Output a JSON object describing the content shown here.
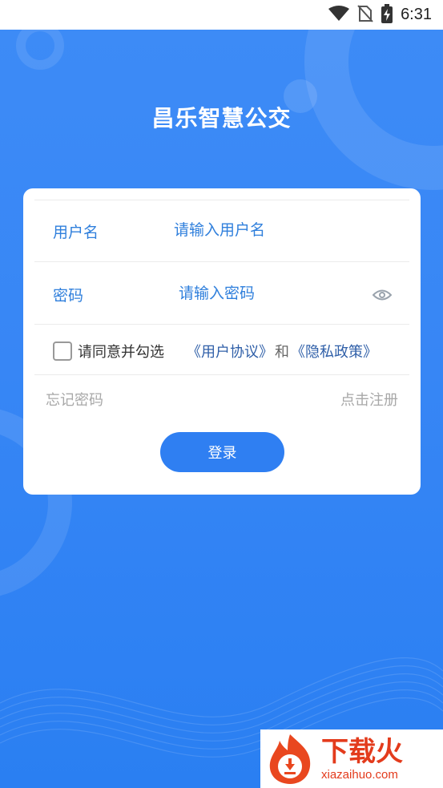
{
  "status_bar": {
    "time": "6:31",
    "icons": [
      "wifi-icon",
      "no-sim-icon",
      "battery-charging-icon"
    ]
  },
  "app": {
    "title": "昌乐智慧公交"
  },
  "login_form": {
    "username_label": "用户名",
    "username_placeholder": "请输入用户名",
    "password_label": "密码",
    "password_placeholder": "请输入密码",
    "password_toggle_icon": "eye-icon",
    "agreement_text": "请同意并勾选",
    "user_agreement_link": "《用户协议》",
    "and_text": "和",
    "privacy_policy_link": "《隐私政策》",
    "agreement_checked": false,
    "forgot_password": "忘记密码",
    "register": "点击注册",
    "login_button": "登录"
  },
  "watermark": {
    "brand_cn": "下载火",
    "brand_en": "xiazaihuo.com"
  },
  "colors": {
    "background_blue": "#3786f5",
    "accent": "#2f7ff2",
    "link_blue": "#2f7fdc",
    "watermark_red": "#e33b1c"
  }
}
